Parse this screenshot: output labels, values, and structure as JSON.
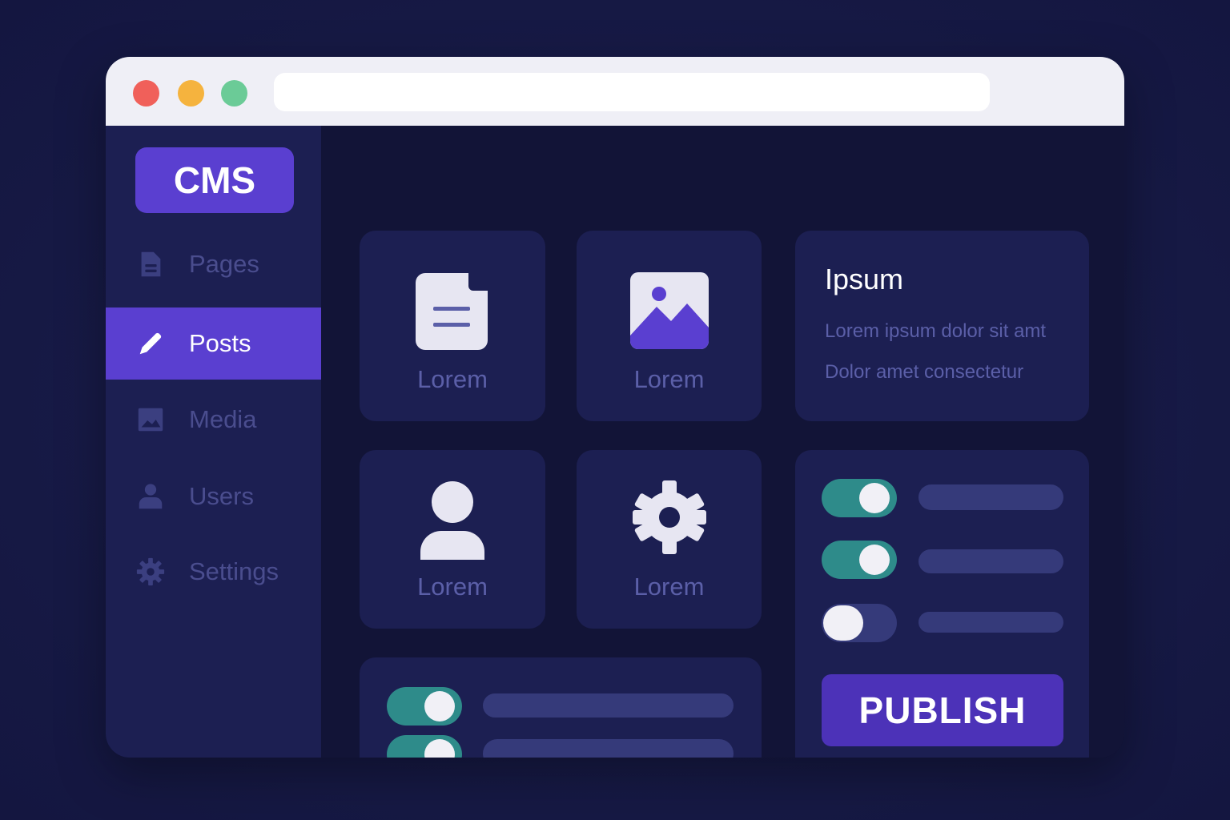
{
  "brand": {
    "label": "CMS"
  },
  "sidebar": {
    "items": [
      {
        "label": "Pages",
        "icon": "document-icon",
        "active": false
      },
      {
        "label": "Posts",
        "icon": "pencil-icon",
        "active": true
      },
      {
        "label": "Media",
        "icon": "image-icon",
        "active": false
      },
      {
        "label": "Users",
        "icon": "user-icon",
        "active": false
      },
      {
        "label": "Settings",
        "icon": "gear-icon",
        "active": false
      }
    ]
  },
  "tiles": [
    {
      "label": "Lorem",
      "icon": "document-icon"
    },
    {
      "label": "Lorem",
      "icon": "image-icon"
    },
    {
      "label": "Lorem",
      "icon": "user-icon"
    },
    {
      "label": "Lorem",
      "icon": "gear-icon"
    }
  ],
  "info": {
    "title": "Ipsum",
    "lines": [
      "Lorem ipsum dolor sit amt",
      "Dolor amet consectetur"
    ]
  },
  "settings_panel": {
    "toggles": [
      {
        "state": "on"
      },
      {
        "state": "on"
      },
      {
        "state": "off"
      }
    ],
    "publish_label": "PUBLISH"
  },
  "bottom_panel": {
    "toggles": [
      {
        "state": "on"
      },
      {
        "state": "on"
      }
    ]
  },
  "colors": {
    "accent": "#5a3fd0",
    "toggle_on": "#2e8b8a",
    "background": "#171a45",
    "card": "#1c1f52"
  }
}
